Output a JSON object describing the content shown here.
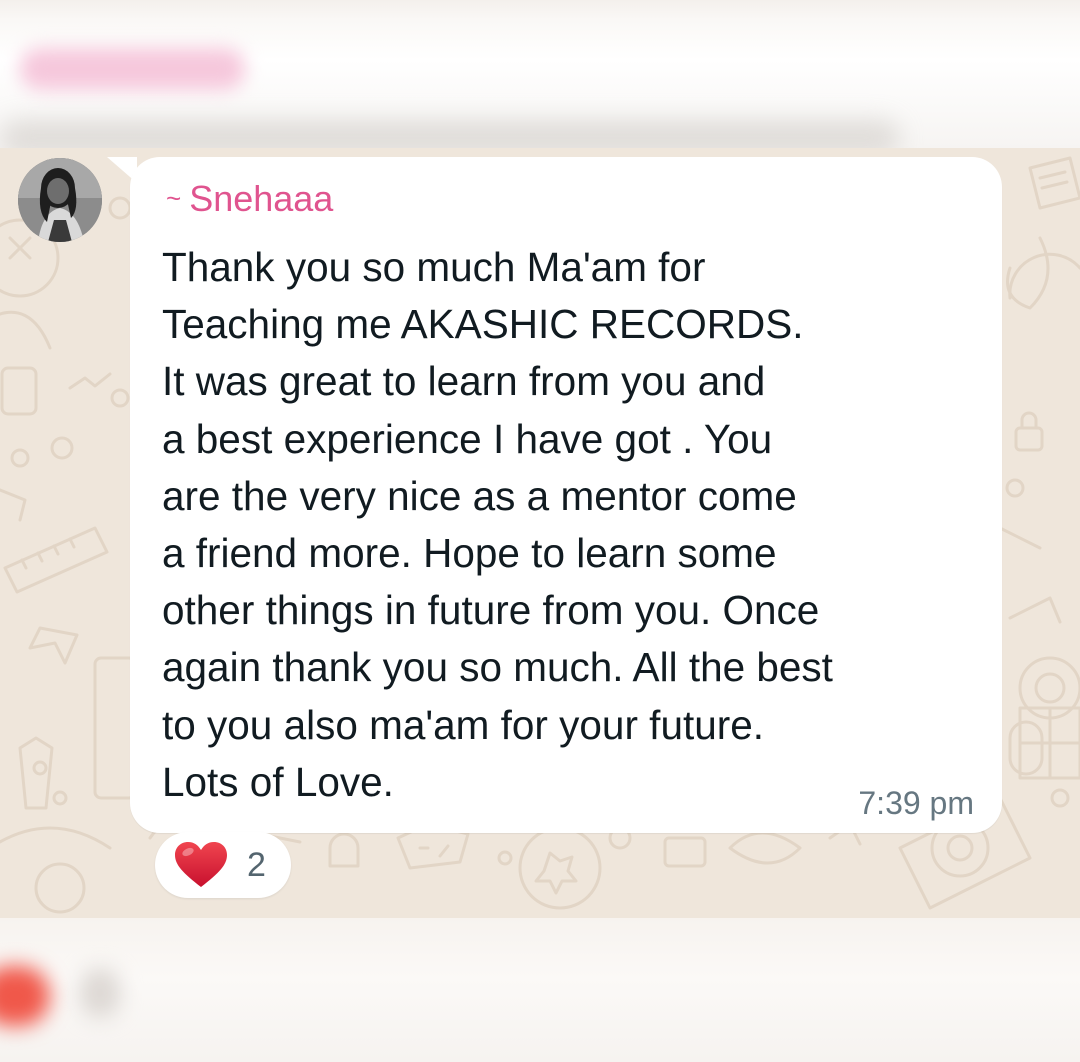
{
  "chat": {
    "sender_prefix": "~",
    "sender_name": "Snehaaa",
    "message_lines": [
      "Thank you so much Ma'am for",
      "Teaching me AKASHIC RECORDS.",
      "It was great to learn from you and",
      "a best experience I have got . You",
      "are the very nice as a mentor come",
      "a friend more. Hope to learn some",
      "other things in future from you. Once",
      "again thank you so much. All the best",
      "to you also ma'am for your future.",
      "Lots of Love."
    ],
    "timestamp": "7:39 pm",
    "reaction": {
      "emoji": "heart",
      "count": "2"
    }
  },
  "colors": {
    "sender_name": "#e0548f",
    "wallpaper": "#efe6db",
    "bubble": "#ffffff",
    "timestamp": "#667781",
    "heart": "#e0263d"
  }
}
